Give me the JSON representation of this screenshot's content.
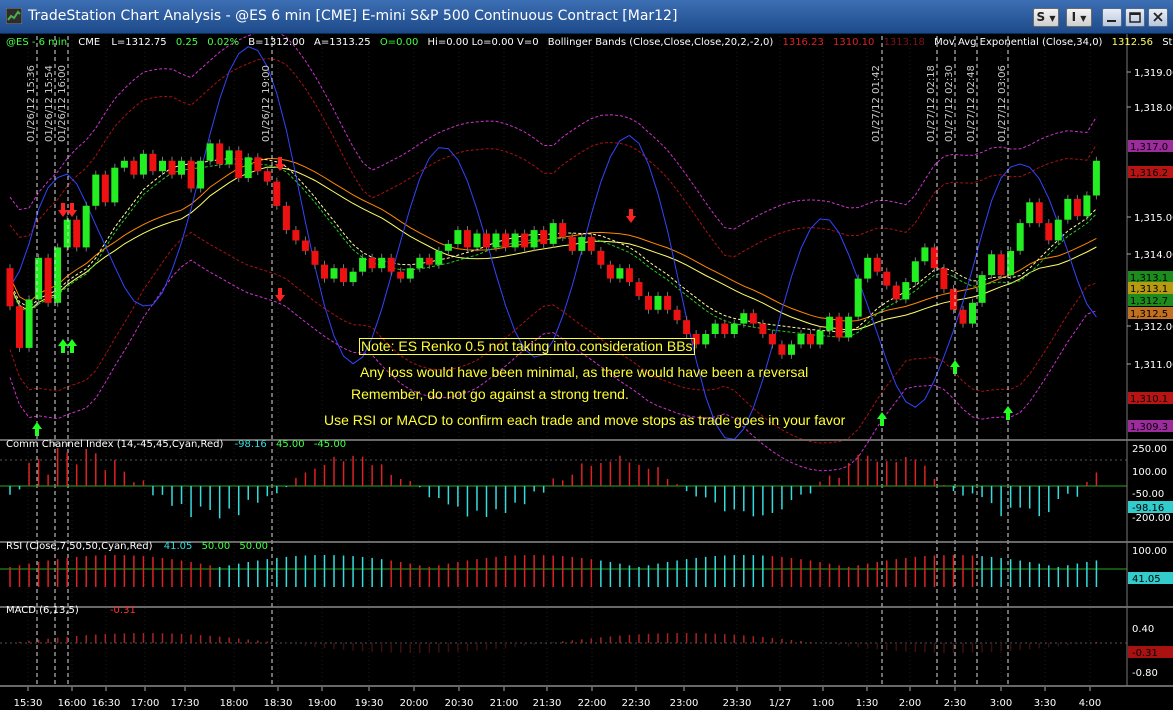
{
  "window": {
    "title": "TradeStation Chart Analysis - @ES 6 min [CME] E-mini S&P 500 Continuous Contract [Mar12]",
    "buttons": {
      "style": "S",
      "layout": "I"
    },
    "accent": "#1d4a8a"
  },
  "status": {
    "symbol": "@ES - 6 min",
    "exchange": "CME",
    "last": "L=1312.75",
    "change": "0.25",
    "pct": "0.02%",
    "bid": "B=1312.00",
    "ask": "A=1313.25",
    "open": "O=0.00",
    "hilo": "Hi=0.00  Lo=0.00  V=0",
    "bb_label": "Bollinger Bands (Close,Close,Close,20,2,-2,0)",
    "bb_v1": "1316.23",
    "bb_v2": "1310.10",
    "bb_v3": "1313.18",
    "ma_label": "Mov Avg Exponential (Close,34,0)",
    "ma_v": "1312.56",
    "stoch": "Stochasti ..."
  },
  "chart_data": {
    "type": "candlestick",
    "x_ticks": [
      "15:30",
      "16:00",
      "16:30",
      "17:00",
      "17:30",
      "18:00",
      "18:30",
      "19:00",
      "19:30",
      "20:00",
      "20:30",
      "21:00",
      "21:30",
      "22:00",
      "22:30",
      "23:00",
      "23:30",
      "1/27",
      "1:00",
      "1:30",
      "2:00",
      "2:30",
      "3:00",
      "3:30",
      "4:00"
    ],
    "price_ticks": [
      "1,319.00",
      "1,318.00",
      "1,315.00",
      "1,314.00",
      "1,312.00",
      "1,311.00"
    ],
    "price_labels": [
      {
        "text": "1,317.0",
        "color": "#9c2c9c"
      },
      {
        "text": "1,316.2",
        "color": "#b81414"
      },
      {
        "text": "1,313.1",
        "color": "#1c8c1c"
      },
      {
        "text": "1,313.1",
        "color": "#b89a10"
      },
      {
        "text": "1,312.7",
        "color": "#1c8c1c"
      },
      {
        "text": "1,312.5",
        "color": "#c07020"
      },
      {
        "text": "1,310.1",
        "color": "#b81414"
      },
      {
        "text": "1,309.3",
        "color": "#9c2c9c"
      }
    ],
    "trade_timestamps": [
      "01/26/12 15:36",
      "01/26/12 15:54",
      "01/26/12 16:00",
      "01/26/12 19:00",
      "01/27/12 01:42",
      "01/27/12 02:18",
      "01/27/12 02:30",
      "01/27/12 02:48",
      "01/27/12 03:06"
    ],
    "candles": [
      {
        "o": 1313.5,
        "c": 1312.4
      },
      {
        "o": 1312.4,
        "c": 1311.2
      },
      {
        "o": 1311.2,
        "c": 1312.6
      },
      {
        "o": 1312.6,
        "c": 1313.8
      },
      {
        "o": 1313.8,
        "c": 1312.5
      },
      {
        "o": 1312.5,
        "c": 1314.1
      },
      {
        "o": 1314.1,
        "c": 1314.9
      },
      {
        "o": 1314.9,
        "c": 1314.1
      },
      {
        "o": 1314.1,
        "c": 1315.3
      },
      {
        "o": 1315.3,
        "c": 1316.2
      },
      {
        "o": 1316.2,
        "c": 1315.4
      },
      {
        "o": 1315.4,
        "c": 1316.4
      },
      {
        "o": 1316.4,
        "c": 1316.6
      },
      {
        "o": 1316.6,
        "c": 1316.2
      },
      {
        "o": 1316.2,
        "c": 1316.8
      },
      {
        "o": 1316.8,
        "c": 1316.3
      },
      {
        "o": 1316.3,
        "c": 1316.6
      },
      {
        "o": 1316.6,
        "c": 1316.2
      },
      {
        "o": 1316.2,
        "c": 1316.6
      },
      {
        "o": 1316.6,
        "c": 1315.8
      },
      {
        "o": 1315.8,
        "c": 1316.6
      },
      {
        "o": 1316.6,
        "c": 1317.1
      },
      {
        "o": 1317.1,
        "c": 1316.5
      },
      {
        "o": 1316.5,
        "c": 1316.9
      },
      {
        "o": 1316.9,
        "c": 1316.1
      },
      {
        "o": 1316.1,
        "c": 1316.7
      },
      {
        "o": 1316.7,
        "c": 1316.3
      },
      {
        "o": 1316.3,
        "c": 1316.0
      },
      {
        "o": 1316.0,
        "c": 1315.3
      },
      {
        "o": 1315.3,
        "c": 1314.6
      },
      {
        "o": 1314.6,
        "c": 1314.3
      },
      {
        "o": 1314.3,
        "c": 1314.0
      },
      {
        "o": 1314.0,
        "c": 1313.6
      },
      {
        "o": 1313.6,
        "c": 1313.2
      },
      {
        "o": 1313.2,
        "c": 1313.5
      },
      {
        "o": 1313.5,
        "c": 1313.1
      },
      {
        "o": 1313.1,
        "c": 1313.4
      },
      {
        "o": 1313.4,
        "c": 1313.8
      },
      {
        "o": 1313.8,
        "c": 1313.5
      },
      {
        "o": 1313.5,
        "c": 1313.8
      },
      {
        "o": 1313.8,
        "c": 1313.4
      },
      {
        "o": 1313.4,
        "c": 1313.2
      },
      {
        "o": 1313.2,
        "c": 1313.5
      },
      {
        "o": 1313.5,
        "c": 1313.8
      },
      {
        "o": 1313.8,
        "c": 1313.6
      },
      {
        "o": 1313.6,
        "c": 1314.0
      },
      {
        "o": 1314.0,
        "c": 1314.2
      },
      {
        "o": 1314.2,
        "c": 1314.6
      },
      {
        "o": 1314.6,
        "c": 1314.1
      },
      {
        "o": 1314.1,
        "c": 1314.5
      },
      {
        "o": 1314.5,
        "c": 1314.1
      },
      {
        "o": 1314.1,
        "c": 1314.5
      },
      {
        "o": 1314.5,
        "c": 1314.1
      },
      {
        "o": 1314.1,
        "c": 1314.5
      },
      {
        "o": 1314.5,
        "c": 1314.1
      },
      {
        "o": 1314.1,
        "c": 1314.6
      },
      {
        "o": 1314.6,
        "c": 1314.2
      },
      {
        "o": 1314.2,
        "c": 1314.8
      },
      {
        "o": 1314.8,
        "c": 1314.4
      },
      {
        "o": 1314.4,
        "c": 1314.0
      },
      {
        "o": 1314.0,
        "c": 1314.4
      },
      {
        "o": 1314.4,
        "c": 1314.0
      },
      {
        "o": 1314.0,
        "c": 1313.6
      },
      {
        "o": 1313.6,
        "c": 1313.2
      },
      {
        "o": 1313.2,
        "c": 1313.5
      },
      {
        "o": 1313.5,
        "c": 1313.1
      },
      {
        "o": 1313.1,
        "c": 1312.7
      },
      {
        "o": 1312.7,
        "c": 1312.3
      },
      {
        "o": 1312.3,
        "c": 1312.7
      },
      {
        "o": 1312.7,
        "c": 1312.3
      },
      {
        "o": 1312.3,
        "c": 1312.0
      },
      {
        "o": 1312.0,
        "c": 1311.6
      },
      {
        "o": 1311.6,
        "c": 1311.3
      },
      {
        "o": 1311.3,
        "c": 1311.6
      },
      {
        "o": 1311.6,
        "c": 1311.9
      },
      {
        "o": 1311.9,
        "c": 1311.6
      },
      {
        "o": 1311.6,
        "c": 1311.9
      },
      {
        "o": 1311.9,
        "c": 1312.2
      },
      {
        "o": 1312.2,
        "c": 1311.9
      },
      {
        "o": 1311.9,
        "c": 1311.6
      },
      {
        "o": 1311.6,
        "c": 1311.3
      },
      {
        "o": 1311.3,
        "c": 1311.0
      },
      {
        "o": 1311.0,
        "c": 1311.3
      },
      {
        "o": 1311.3,
        "c": 1311.6
      },
      {
        "o": 1311.6,
        "c": 1311.3
      },
      {
        "o": 1311.3,
        "c": 1311.7
      },
      {
        "o": 1311.7,
        "c": 1312.1
      },
      {
        "o": 1312.1,
        "c": 1311.5
      },
      {
        "o": 1311.5,
        "c": 1312.1
      },
      {
        "o": 1312.1,
        "c": 1313.2
      },
      {
        "o": 1313.2,
        "c": 1313.8
      },
      {
        "o": 1313.8,
        "c": 1313.4
      },
      {
        "o": 1313.4,
        "c": 1313.0
      },
      {
        "o": 1313.0,
        "c": 1312.6
      },
      {
        "o": 1312.6,
        "c": 1313.1
      },
      {
        "o": 1313.1,
        "c": 1313.7
      },
      {
        "o": 1313.7,
        "c": 1314.1
      },
      {
        "o": 1314.1,
        "c": 1313.5
      },
      {
        "o": 1313.5,
        "c": 1312.9
      },
      {
        "o": 1312.9,
        "c": 1312.3
      },
      {
        "o": 1312.3,
        "c": 1311.9
      },
      {
        "o": 1311.9,
        "c": 1312.5
      },
      {
        "o": 1312.5,
        "c": 1313.3
      },
      {
        "o": 1313.3,
        "c": 1313.9
      },
      {
        "o": 1313.9,
        "c": 1313.3
      },
      {
        "o": 1313.3,
        "c": 1314.0
      },
      {
        "o": 1314.0,
        "c": 1314.8
      },
      {
        "o": 1314.8,
        "c": 1315.4
      },
      {
        "o": 1315.4,
        "c": 1314.8
      },
      {
        "o": 1314.8,
        "c": 1314.3
      },
      {
        "o": 1314.3,
        "c": 1314.9
      },
      {
        "o": 1314.9,
        "c": 1315.5
      },
      {
        "o": 1315.5,
        "c": 1315.0
      },
      {
        "o": 1315.0,
        "c": 1315.6
      },
      {
        "o": 1315.6,
        "c": 1316.6
      }
    ],
    "cci": {
      "label": "Comm Channel Index (14,-45,45,Cyan,Red)",
      "v1": "-98.16",
      "v2": "45.00",
      "v3": "-45.00",
      "ticks": [
        "250.00",
        "100.00",
        "-50.00",
        "-200.00"
      ],
      "current": "-98.16"
    },
    "rsi": {
      "label": "RSI (Close,7,50,50,Cyan,Red)",
      "v1": "41.05",
      "v2": "50.00",
      "v3": "50.00",
      "ticks": [
        "100.00"
      ],
      "current": "41.05"
    },
    "macd": {
      "label": "MACD (6,13,5)",
      "v1": "-0.31",
      "ticks": [
        "0.40",
        "-0.80"
      ],
      "current": "-0.31"
    },
    "colors": {
      "up": "#22ee22",
      "down": "#ee1111",
      "bb": "#cc33cc",
      "ema": "#ff8800",
      "sma": "#ffff66",
      "stoch": "#3344ff",
      "cyan": "#33dddd",
      "red": "#dd2222"
    }
  },
  "annotations": {
    "note1": "Note: ES Renko 0.5 not taking into consideration BBs",
    "note2": "Any loss would have been minimal, as there would have been a reversal",
    "note3": "Remember, do not go against a strong trend.",
    "note4": "Use RSI or MACD to confirm each trade and move stops as trade goes in your favor"
  }
}
